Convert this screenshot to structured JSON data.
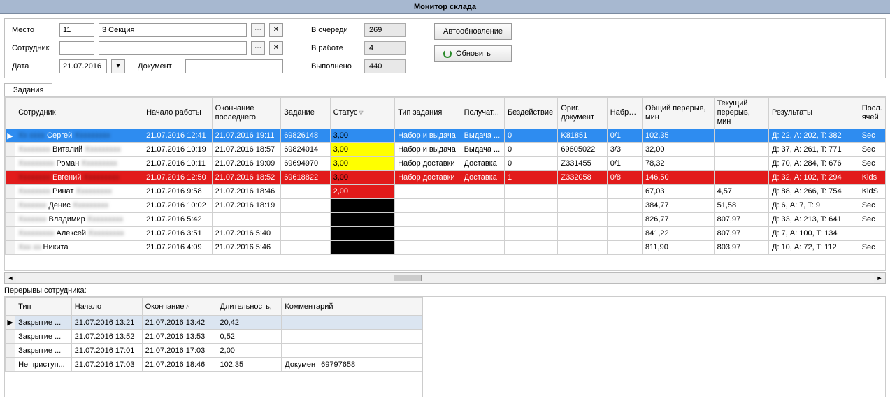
{
  "title": "Монитор склада",
  "filters": {
    "place_label": "Место",
    "place_code": "11",
    "place_name": "3 Секция",
    "employee_label": "Сотрудник",
    "employee_code": "",
    "employee_name": "",
    "date_label": "Дата",
    "date_value": "21.07.2016",
    "doc_label": "Документ",
    "doc_value": ""
  },
  "stats": {
    "queue_label": "В очереди",
    "queue_value": "269",
    "inwork_label": "В работе",
    "inwork_value": "4",
    "done_label": "Выполнено",
    "done_value": "440"
  },
  "buttons": {
    "autorefresh": "Автообновление",
    "refresh": "Обновить"
  },
  "tab": "Задания",
  "task_columns": [
    "Сотрудник",
    "Начало работы",
    "Окончание последнего",
    "Задание",
    "Статус",
    "Тип задания",
    "Получат...",
    "Бездействие",
    "Ориг. документ",
    "Набрано",
    "Общий перерыв, мин",
    "Текущий перерыв, мин",
    "Результаты",
    "Посл. ячей"
  ],
  "task_rows": [
    {
      "cls": "row-blue",
      "sel": "▶",
      "emp_blur": "Xx xxxx",
      "emp": "Сергей",
      "start": "21.07.2016 12:41",
      "end": "21.07.2016 19:11",
      "task": "69826148",
      "status": "3,00",
      "stcls": "st-yellow",
      "type": "Набор и выдача",
      "recv": "Выдача ...",
      "idle": "0",
      "doc": "K81851",
      "picked": "0/1",
      "total": "102,35",
      "cur": "",
      "res": "Д: 22, A: 202, T: 382",
      "cell": "Sec"
    },
    {
      "cls": "",
      "sel": "",
      "emp_blur": "Xxxxxxxx",
      "emp": "Виталий",
      "start": "21.07.2016 10:19",
      "end": "21.07.2016 18:57",
      "task": "69824014",
      "status": "3,00",
      "stcls": "st-yellow",
      "type": "Набор и выдача",
      "recv": "Выдача ...",
      "idle": "0",
      "doc": "69605022",
      "picked": "3/3",
      "total": "32,00",
      "cur": "",
      "res": "Д: 37, A: 261, T: 771",
      "cell": "Sec"
    },
    {
      "cls": "",
      "sel": "",
      "emp_blur": "Xxxxxxxxx",
      "emp": "Роман",
      "start": "21.07.2016 10:11",
      "end": "21.07.2016 19:09",
      "task": "69694970",
      "status": "3,00",
      "stcls": "st-yellow",
      "type": "Набор доставки",
      "recv": "Доставка",
      "idle": "0",
      "doc": "Z331455",
      "picked": "0/1",
      "total": "78,32",
      "cur": "",
      "res": "Д: 70, A: 284, T: 676",
      "cell": "Sec"
    },
    {
      "cls": "row-red",
      "sel": "",
      "emp_blur": "Xxxxxxxx",
      "emp": "Евгений",
      "start": "21.07.2016 12:50",
      "end": "21.07.2016 18:52",
      "task": "69618822",
      "status": "3,00",
      "stcls": "st-yellow",
      "type": "Набор доставки",
      "recv": "Доставка",
      "idle": "1",
      "doc": "Z332058",
      "picked": "0/8",
      "total": "146,50",
      "cur": "",
      "res": "Д: 32, A: 102, T: 294",
      "cell": "Kids"
    },
    {
      "cls": "",
      "sel": "",
      "emp_blur": "Xxxxxxxx",
      "emp": "Ринат",
      "start": "21.07.2016 9:58",
      "end": "21.07.2016 18:46",
      "task": "",
      "status": "2,00",
      "stcls": "st-red",
      "type": "",
      "recv": "",
      "idle": "",
      "doc": "",
      "picked": "",
      "total": "67,03",
      "cur": "4,57",
      "res": "Д: 88, A: 266, T: 754",
      "cell": "KidS"
    },
    {
      "cls": "",
      "sel": "",
      "emp_blur": "Xxxxxxx",
      "emp": "Денис",
      "start": "21.07.2016 10:02",
      "end": "21.07.2016 18:19",
      "task": "",
      "status": "",
      "stcls": "st-black",
      "type": "",
      "recv": "",
      "idle": "",
      "doc": "",
      "picked": "",
      "total": "384,77",
      "cur": "51,58",
      "res": "Д: 6, A: 7, T: 9",
      "cell": "Sec"
    },
    {
      "cls": "",
      "sel": "",
      "emp_blur": "Xxxxxxx",
      "emp": "Владимир",
      "start": "21.07.2016 5:42",
      "end": "",
      "task": "",
      "status": "",
      "stcls": "st-black",
      "type": "",
      "recv": "",
      "idle": "",
      "doc": "",
      "picked": "",
      "total": "826,77",
      "cur": "807,97",
      "res": "Д: 33, A: 213, T: 641",
      "cell": "Sec"
    },
    {
      "cls": "",
      "sel": "",
      "emp_blur": "Xxxxxxxxx",
      "emp": "Алексей",
      "start": "21.07.2016 3:51",
      "end": "21.07.2016 5:40",
      "task": "",
      "status": "",
      "stcls": "st-black",
      "type": "",
      "recv": "",
      "idle": "",
      "doc": "",
      "picked": "",
      "total": "841,22",
      "cur": "807,97",
      "res": "Д: 7, A: 100, T: 134",
      "cell": ""
    },
    {
      "cls": "",
      "sel": "",
      "emp_blur": "Xxx xx",
      "emp": "Никита",
      "start": "21.07.2016 4:09",
      "end": "21.07.2016 5:46",
      "task": "",
      "status": "",
      "stcls": "st-black",
      "type": "",
      "recv": "",
      "idle": "",
      "doc": "",
      "picked": "",
      "total": "811,90",
      "cur": "803,97",
      "res": "Д: 10, A: 72, T: 112",
      "cell": "Sec"
    }
  ],
  "breaks_label": "Перерывы сотрудника:",
  "break_columns": [
    "Тип",
    "Начало",
    "Окончание",
    "Длительность,",
    "Комментарий"
  ],
  "break_rows": [
    {
      "sel": "▶",
      "cls": "row-sel",
      "type": "Закрытие ...",
      "start": "21.07.2016 13:21",
      "end": "21.07.2016 13:42",
      "dur": "20,42",
      "comment": ""
    },
    {
      "sel": "",
      "cls": "",
      "type": "Закрытие ...",
      "start": "21.07.2016 13:52",
      "end": "21.07.2016 13:53",
      "dur": "0,52",
      "comment": ""
    },
    {
      "sel": "",
      "cls": "",
      "type": "Закрытие ...",
      "start": "21.07.2016 17:01",
      "end": "21.07.2016 17:03",
      "dur": "2,00",
      "comment": ""
    },
    {
      "sel": "",
      "cls": "",
      "type": "Не приступ...",
      "start": "21.07.2016 17:03",
      "end": "21.07.2016 18:46",
      "dur": "102,35",
      "comment": "Документ 69797658"
    }
  ]
}
